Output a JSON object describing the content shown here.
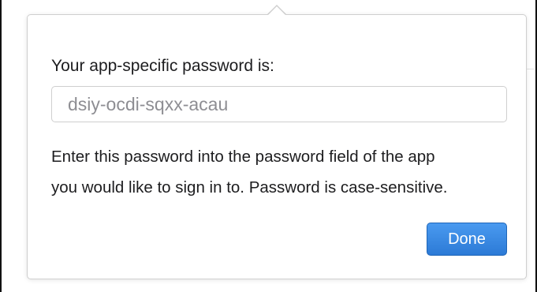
{
  "dialog": {
    "heading": "Your app-specific password is:",
    "password_value": "dsiy-ocdi-sqxx-acau",
    "description_line1": "Enter this password into the password field of the app",
    "description_line2": "you would like to sign in to. Password is case-sensitive.",
    "done_label": "Done"
  },
  "colors": {
    "button_blue": "#2c7ad6",
    "text": "#1d1d1f",
    "field_text": "#8e8e93"
  }
}
